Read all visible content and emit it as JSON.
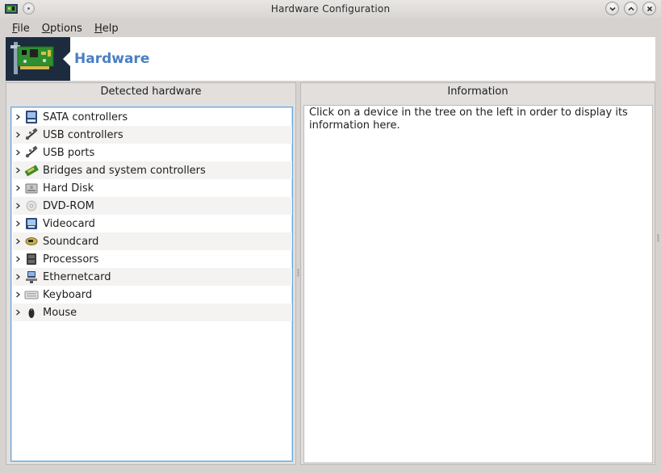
{
  "window": {
    "title": "Hardware Configuration",
    "controls": [
      "minimize",
      "maximize",
      "close"
    ]
  },
  "menubar": {
    "items": [
      {
        "mnemonic": "F",
        "rest": "ile"
      },
      {
        "mnemonic": "O",
        "rest": "ptions"
      },
      {
        "mnemonic": "H",
        "rest": "elp"
      }
    ]
  },
  "banner": {
    "title": "Hardware",
    "title_color": "#4a7fc1"
  },
  "left_panel": {
    "header": "Detected hardware",
    "tree": [
      {
        "label": "SATA controllers",
        "icon": "sata-controller-icon"
      },
      {
        "label": "USB controllers",
        "icon": "usb-icon"
      },
      {
        "label": "USB ports",
        "icon": "usb-icon"
      },
      {
        "label": "Bridges and system controllers",
        "icon": "bridge-chip-icon"
      },
      {
        "label": "Hard Disk",
        "icon": "hard-disk-icon"
      },
      {
        "label": "DVD-ROM",
        "icon": "dvd-icon"
      },
      {
        "label": "Videocard",
        "icon": "videocard-icon"
      },
      {
        "label": "Soundcard",
        "icon": "soundcard-icon"
      },
      {
        "label": "Processors",
        "icon": "processor-icon"
      },
      {
        "label": "Ethernetcard",
        "icon": "ethernet-icon"
      },
      {
        "label": "Keyboard",
        "icon": "keyboard-icon"
      },
      {
        "label": "Mouse",
        "icon": "mouse-icon"
      }
    ]
  },
  "right_panel": {
    "header": "Information",
    "text": "Click on a device in the tree on the left in order to display its information here."
  }
}
